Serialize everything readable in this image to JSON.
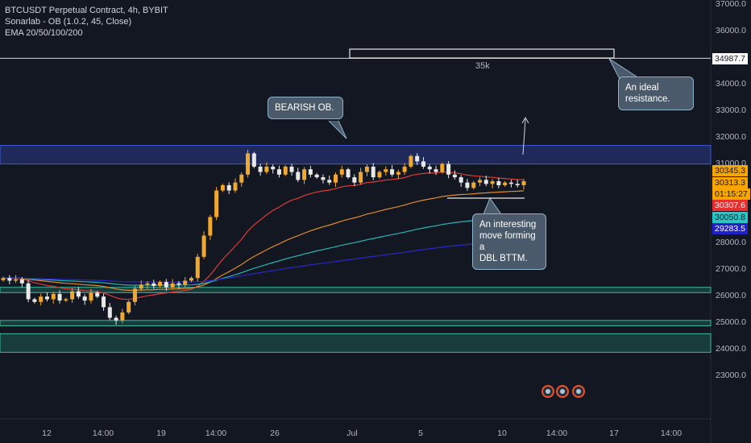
{
  "legend": {
    "symbol": "BTCUSDT Perpetual Contract, 4h, BYBIT",
    "indicator1": "Sonarlab - OB (1.0.2, 45, Close)",
    "indicator2": "EMA 20/50/100/200"
  },
  "annotations": {
    "bearish_ob": "BEARISH OB.",
    "ideal_resistance": "An ideal\nresistance.",
    "dbl_bttm": "An interesting\nmove forming a\nDBL BTTM.",
    "level_label": "35k"
  },
  "price_tags": {
    "resistance_level": "34987.7",
    "last_price": "30345.3",
    "ema_orange": "30313.3",
    "countdown": "01:15:27",
    "ema_red": "30307.6",
    "ema_teal": "30050.8",
    "ema_blue": "29283.5"
  },
  "colors": {
    "background": "#131722",
    "up": "#f0a830",
    "down": "#e8e8e8",
    "ema20": "#e03a3a",
    "ema50": "#e08a2a",
    "ema100": "#26b5b5",
    "ema200": "#2828c8",
    "bear_ob": "#2a3a8a",
    "bull_ob": "#1e5a50"
  },
  "chart_data": {
    "type": "candlestick",
    "title": "BTCUSDT Perpetual Contract, 4h, BYBIT",
    "y_ticks": [
      23000,
      24000,
      25000,
      26000,
      27000,
      28000,
      29000,
      30000,
      31000,
      32000,
      33000,
      34000,
      35000,
      36000,
      37000
    ],
    "ylim": [
      22000,
      37000
    ],
    "x_ticks": [
      "12",
      "14:00",
      "19",
      "14:00",
      "26",
      "Jul",
      "5",
      "10",
      "14:00",
      "17",
      "14:00"
    ],
    "horizontal_levels": [
      34987.7
    ],
    "series_names": [
      "EMA 20",
      "EMA 50",
      "EMA 100",
      "EMA 200"
    ],
    "ema_last": {
      "ema20": 30307.6,
      "ema50": 30313.3,
      "ema100": 30050.8,
      "ema200": 29283.5
    },
    "last_price": 30345.3,
    "bearish_ob_zone": [
      31000,
      31700
    ],
    "bullish_ob_zones": [
      [
        26150,
        26350
      ],
      [
        24900,
        25100
      ],
      [
        23900,
        24600
      ]
    ],
    "candles_close": [
      26700,
      26600,
      26650,
      26500,
      25900,
      25800,
      26000,
      25900,
      26100,
      25850,
      25900,
      26200,
      26000,
      25850,
      26150,
      26000,
      25600,
      25200,
      25100,
      25400,
      25800,
      26300,
      26450,
      26500,
      26400,
      26550,
      26350,
      26500,
      26450,
      26600,
      26700,
      27500,
      28300,
      29000,
      30000,
      30200,
      30000,
      30300,
      30600,
      31400,
      30900,
      30700,
      30900,
      30800,
      30600,
      30900,
      30700,
      30400,
      30800,
      30600,
      30500,
      30400,
      30300,
      30600,
      30800,
      30500,
      30300,
      30700,
      30900,
      30500,
      30700,
      30800,
      30600,
      30700,
      30900,
      31300,
      31100,
      30900,
      30800,
      30700,
      31000,
      30600,
      30500,
      30300,
      30100,
      30300,
      30400,
      30250,
      30350,
      30200,
      30300,
      30250,
      30200,
      30350
    ]
  }
}
